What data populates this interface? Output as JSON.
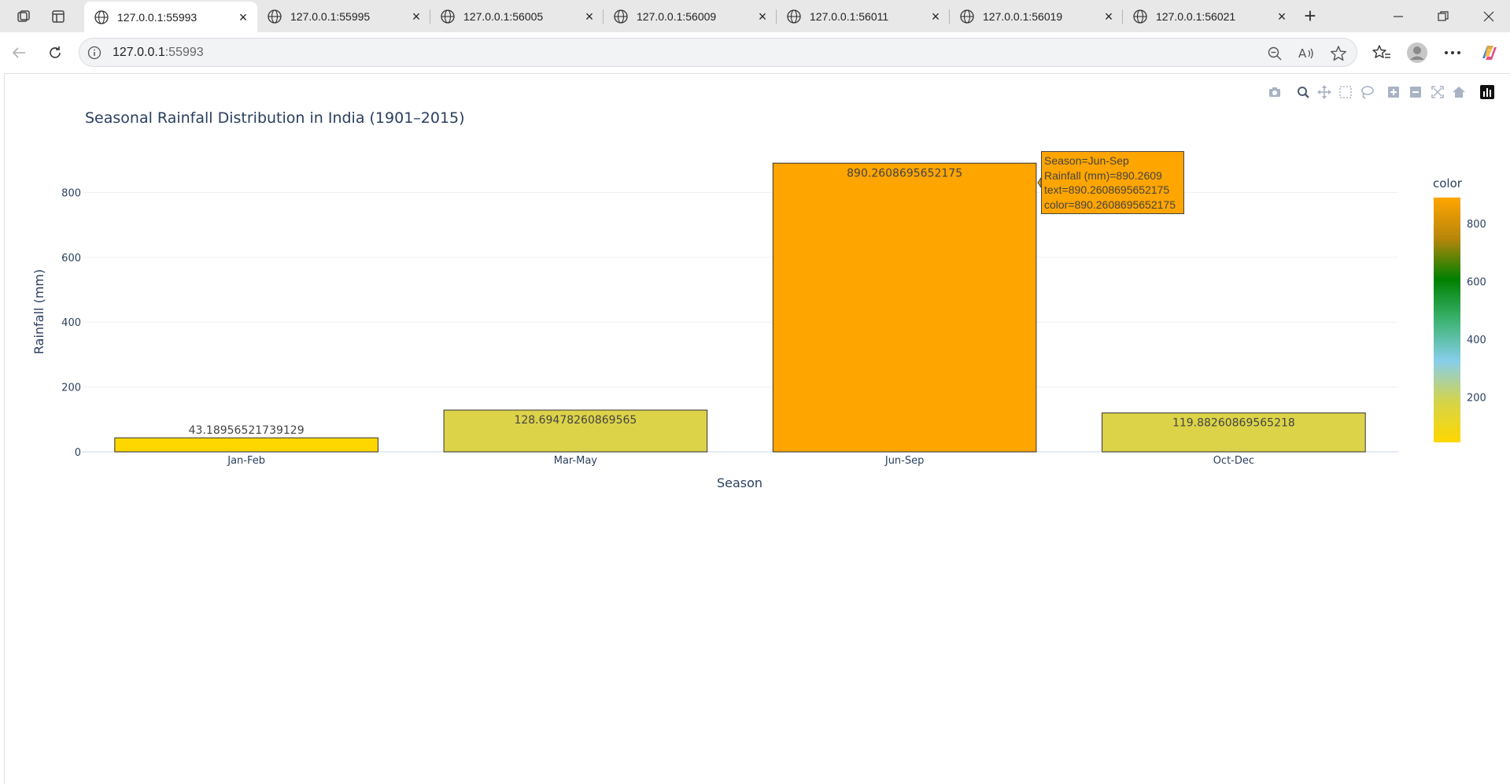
{
  "browser": {
    "tabs": [
      {
        "title": "127.0.0.1:55993",
        "active": true
      },
      {
        "title": "127.0.0.1:55995",
        "active": false
      },
      {
        "title": "127.0.0.1:56005",
        "active": false
      },
      {
        "title": "127.0.0.1:56009",
        "active": false
      },
      {
        "title": "127.0.0.1:56011",
        "active": false
      },
      {
        "title": "127.0.0.1:56019",
        "active": false
      },
      {
        "title": "127.0.0.1:56021",
        "active": false
      }
    ],
    "address": {
      "host": "127.0.0.1",
      "port": ":55993"
    },
    "icons": {
      "workspaces": "workspaces-icon",
      "tab_actions": "tab-actions-icon",
      "new_tab": "plus-icon",
      "back": "back-arrow-icon",
      "reload": "reload-icon",
      "site_info": "info-icon",
      "zoom": "zoom-out-icon",
      "read_aloud": "read-aloud-icon",
      "favorite": "star-icon",
      "favorites": "favorites-icon",
      "profile": "avatar-icon",
      "more": "more-icon",
      "copilot": "copilot-icon"
    }
  },
  "plot": {
    "title": "Seasonal Rainfall Distribution in India (1901–2015)",
    "modebar": [
      "camera-icon",
      "zoom-icon",
      "pan-icon",
      "box-select-icon",
      "lasso-icon",
      "zoom-in-icon",
      "zoom-out-icon",
      "autoscale-icon",
      "reset-axes-icon",
      "plotly-logo-icon"
    ],
    "hover": {
      "lines": [
        "Season=Jun-Sep",
        "Rainfall (mm)=890.2609",
        "text=890.2608695652175",
        "color=890.2608695652175"
      ]
    },
    "colorbar": {
      "title": "color",
      "ticks": [
        "200",
        "400",
        "600",
        "800"
      ],
      "colors": [
        "#ffd700",
        "#d4d44a",
        "#87ceeb",
        "#3cb371",
        "#008000",
        "#b8860b",
        "#ffa500"
      ]
    }
  },
  "chart_data": {
    "type": "bar",
    "title": "Seasonal Rainfall Distribution in India (1901–2015)",
    "xlabel": "Season",
    "ylabel": "Rainfall (mm)",
    "categories": [
      "Jan-Feb",
      "Mar-May",
      "Jun-Sep",
      "Oct-Dec"
    ],
    "values": [
      43.18956521739129,
      128.69478260869565,
      890.2608695652175,
      119.88260869565218
    ],
    "labels": [
      "43.18956521739129",
      "128.69478260869565",
      "890.2608695652175",
      "119.88260869565218"
    ],
    "colors": [
      "#ffd700",
      "#dcd348",
      "#ffa500",
      "#dcd348"
    ],
    "y_ticks": [
      "0",
      "200",
      "400",
      "600",
      "800"
    ],
    "ylim": [
      0,
      937
    ],
    "grid": true,
    "legend": "colorbar-right"
  }
}
